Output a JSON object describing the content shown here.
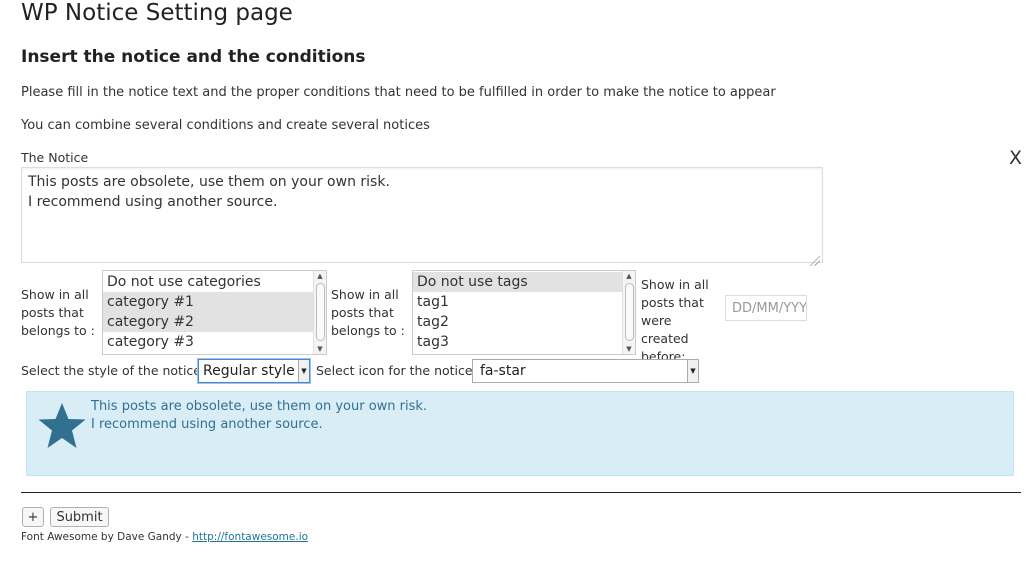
{
  "page": {
    "title": "WP Notice Setting page",
    "section_title": "Insert the notice and the conditions",
    "help_line_1": "Please fill in the notice text and the proper conditions that need to be fulfilled in order to make the notice to appear",
    "help_line_2": "You can combine several conditions and create several notices"
  },
  "notice": {
    "label": "The Notice",
    "close": "X",
    "text": "This posts are obsolete, use them on your own risk.\nI recommend using another source."
  },
  "categories": {
    "label_lines": [
      "Show in all",
      "posts that",
      "belongs to :"
    ],
    "options": [
      {
        "label": "Do not use categories",
        "selected": false
      },
      {
        "label": "category #1",
        "selected": true
      },
      {
        "label": "category #2",
        "selected": true
      },
      {
        "label": "category #3",
        "selected": false
      }
    ]
  },
  "tags": {
    "label_lines": [
      "Show in all",
      "posts that",
      "belongs to :"
    ],
    "options": [
      {
        "label": "Do not use tags",
        "selected": true
      },
      {
        "label": "tag1",
        "selected": false
      },
      {
        "label": "tag2",
        "selected": false
      },
      {
        "label": "tag3",
        "selected": false
      }
    ]
  },
  "date": {
    "label_lines": [
      "Show in all",
      "posts that",
      "were created",
      "before:"
    ],
    "placeholder": "DD/MM/YYYY"
  },
  "style": {
    "label": "Select the style of the notice :",
    "value": "Regular style"
  },
  "icon": {
    "label": "Select icon for the notice :",
    "value": "fa-star",
    "icon_name": "star-icon",
    "color": "#31708f"
  },
  "preview": {
    "line_1": "This posts are obsolete, use them on your own risk.",
    "line_2": "I recommend using another source.",
    "background": "#d9edf7",
    "text_color": "#31708f"
  },
  "buttons": {
    "add": "+",
    "submit": "Submit"
  },
  "credit": {
    "text": "Font Awesome by Dave Gandy - ",
    "link": "http://fontawesome.io"
  }
}
